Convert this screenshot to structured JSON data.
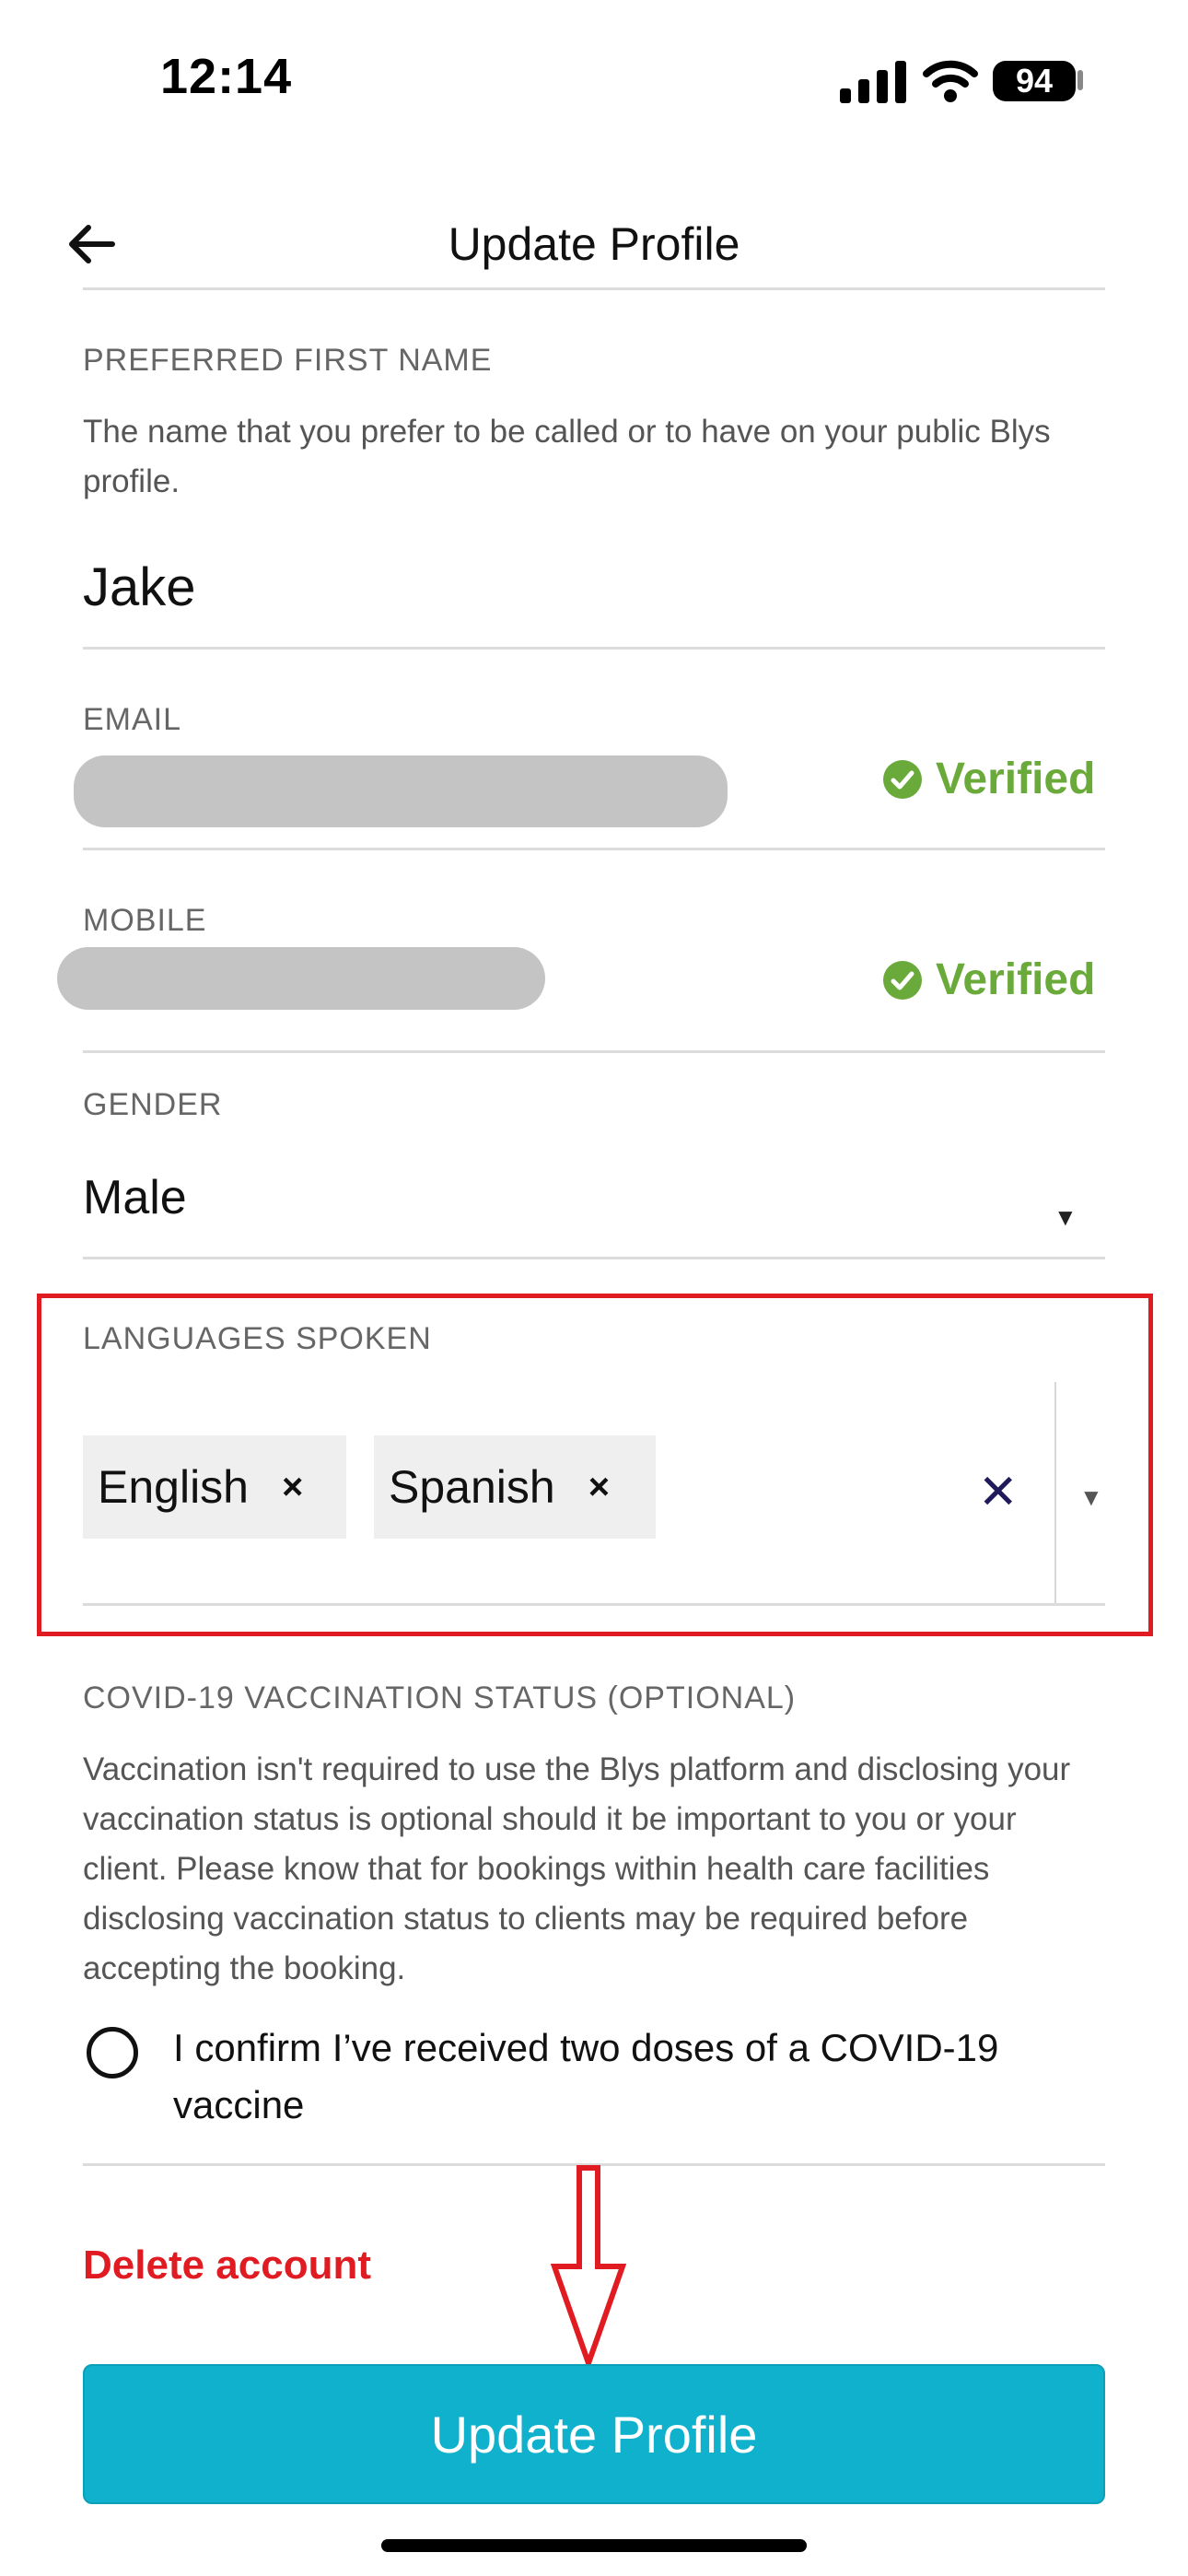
{
  "status_bar": {
    "time": "12:14",
    "battery": "94"
  },
  "header": {
    "title": "Update Profile"
  },
  "first_name": {
    "label": "PREFERRED FIRST NAME",
    "help": "The name that you prefer to be called or to have on your public Blys profile.",
    "value": "Jake"
  },
  "email": {
    "label": "EMAIL",
    "status": "Verified"
  },
  "mobile": {
    "label": "MOBILE",
    "status": "Verified"
  },
  "gender": {
    "label": "GENDER",
    "value": "Male",
    "caret": "▼"
  },
  "languages": {
    "label": "LANGUAGES SPOKEN",
    "chips": [
      {
        "label": "English",
        "remove": "×"
      },
      {
        "label": "Spanish",
        "remove": "×"
      }
    ],
    "clear": "✕",
    "caret": "▼"
  },
  "covid": {
    "label": "COVID-19 VACCINATION STATUS (OPTIONAL)",
    "help": "Vaccination isn't required to use the Blys platform and disclosing your vaccination status is optional should it be important to you or your client. Please know that for bookings within health care facilities disclosing vaccination status to clients may be required before accepting the booking.",
    "confirm": "I confirm I’ve received two doses of a COVID-19 vaccine"
  },
  "delete_account": "Delete account",
  "submit_button": "Update Profile",
  "colors": {
    "accent": "#0fb1cc",
    "danger": "#e11b22",
    "verified": "#6aaa3a"
  }
}
